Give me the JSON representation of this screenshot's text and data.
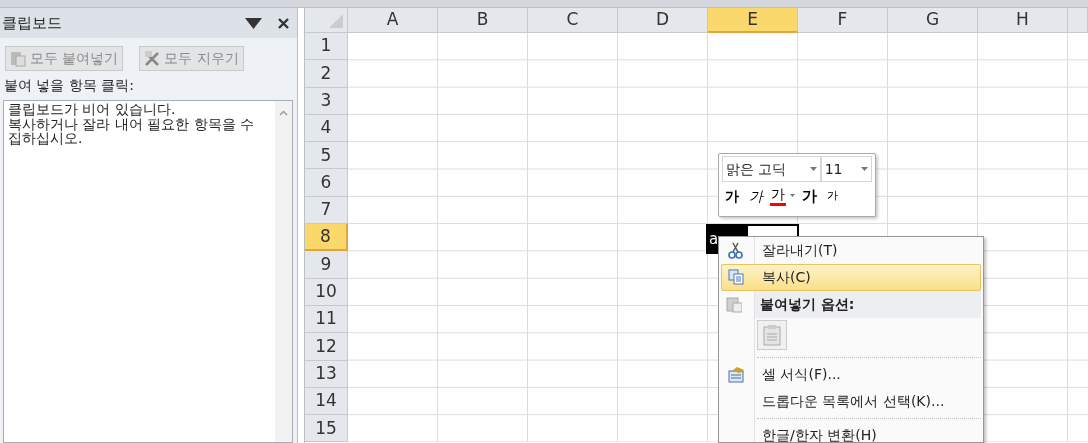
{
  "clipboard_pane": {
    "title": "클립보드",
    "buttons": [
      {
        "kind": "paste_all",
        "label": "모두 붙여넣기",
        "disabled": true
      },
      {
        "kind": "clear_all",
        "label": "모두 지우기",
        "disabled": true
      }
    ],
    "instruction": "붙여 넣을 항목 클릭:",
    "messages": [
      "클립보드가 비어 있습니다.",
      "복사하거나 잘라 내어 필요한 항목을 수집하십시오."
    ]
  },
  "sheet": {
    "columns": [
      {
        "label": "A",
        "selected": false
      },
      {
        "label": "B",
        "selected": false
      },
      {
        "label": "C",
        "selected": false
      },
      {
        "label": "D",
        "selected": false
      },
      {
        "label": "E",
        "selected": true
      },
      {
        "label": "F",
        "selected": false
      },
      {
        "label": "G",
        "selected": false
      },
      {
        "label": "H",
        "selected": false
      }
    ],
    "rows": [
      {
        "label": "1",
        "selected": false
      },
      {
        "label": "2",
        "selected": false
      },
      {
        "label": "3",
        "selected": false
      },
      {
        "label": "4",
        "selected": false
      },
      {
        "label": "5",
        "selected": false
      },
      {
        "label": "6",
        "selected": false
      },
      {
        "label": "7",
        "selected": false
      },
      {
        "label": "8",
        "selected": true
      },
      {
        "label": "9",
        "selected": false
      },
      {
        "label": "10",
        "selected": false
      },
      {
        "label": "11",
        "selected": false
      },
      {
        "label": "12",
        "selected": false
      },
      {
        "label": "13",
        "selected": false
      },
      {
        "label": "14",
        "selected": false
      },
      {
        "label": "15",
        "selected": false
      }
    ],
    "edit_cell": {
      "text": "a"
    }
  },
  "mini_toolbar": {
    "font": "맑은 고딕",
    "size": "11",
    "buttons": [
      {
        "kind": "bold",
        "label": "가"
      },
      {
        "kind": "italic",
        "label": "가"
      },
      {
        "kind": "font_color",
        "label": "가",
        "color": "#ff0000"
      },
      {
        "kind": "grow",
        "label": "가"
      },
      {
        "kind": "shrink",
        "label": "가"
      }
    ]
  },
  "context_menu": {
    "items": [
      {
        "kind": "item",
        "label": "잘라내기(T)",
        "selected": false
      },
      {
        "kind": "item",
        "label": "복사(C)",
        "selected": true
      },
      {
        "kind": "header",
        "label": "붙여넣기 옵션:"
      },
      {
        "kind": "paste_options"
      },
      {
        "kind": "separator"
      },
      {
        "kind": "item",
        "label": "셀 서식(F)...",
        "selected": false
      },
      {
        "kind": "item",
        "label": "드롭다운 목록에서 선택(K)...",
        "selected": false
      },
      {
        "kind": "separator"
      },
      {
        "kind": "item",
        "label": "한글/한자 변환(H)",
        "selected": false
      }
    ]
  }
}
